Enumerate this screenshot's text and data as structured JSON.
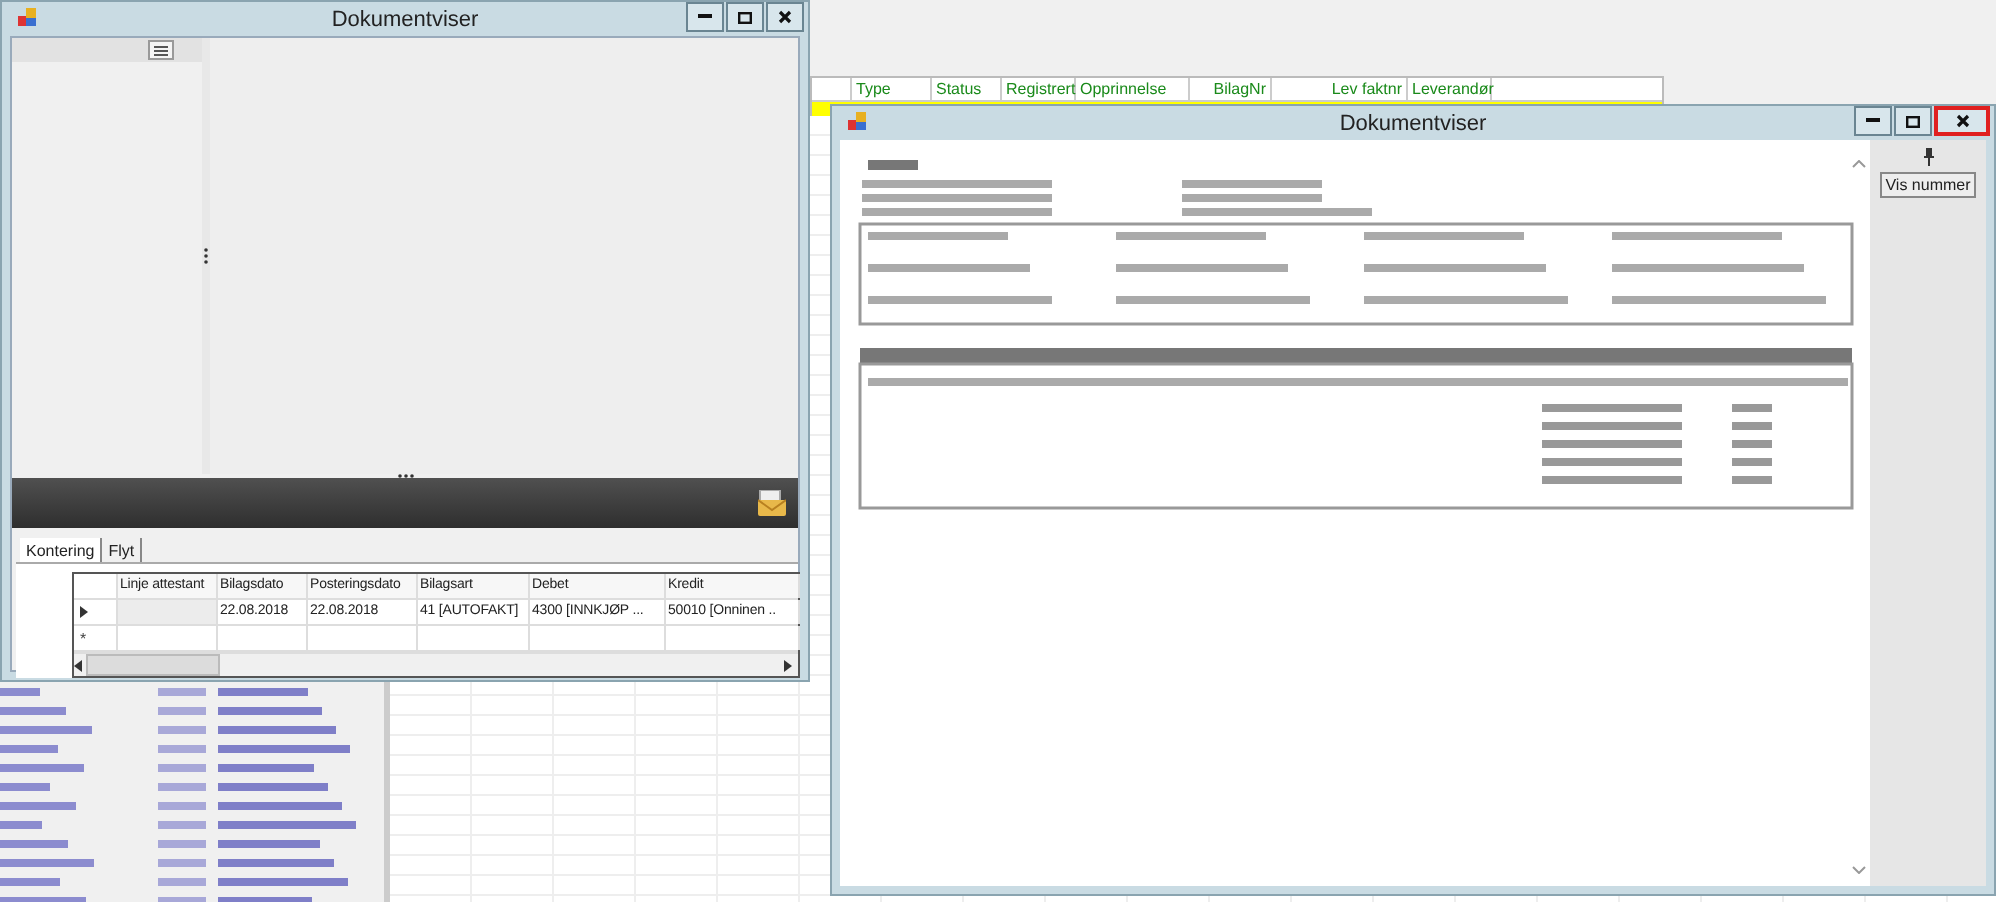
{
  "background_grid": {
    "columns": [
      "Type",
      "Status",
      "Registrert",
      "Opprinnelse",
      "BilagNr",
      "Lev faktnr",
      "Leverandør"
    ]
  },
  "viewer_back": {
    "title": "Dokumentviser",
    "tabs": [
      {
        "label": "Kontering",
        "selected": true
      },
      {
        "label": "Flyt",
        "selected": false
      }
    ],
    "grid": {
      "columns": [
        "Linje attestant",
        "Bilagsdato",
        "Posteringsdato",
        "Bilagsart",
        "Debet",
        "Kredit"
      ],
      "rows": [
        {
          "current": true,
          "cells": [
            "",
            "22.08.2018",
            "22.08.2018",
            "41 [AUTOFAKT]",
            "4300 [INNKJØP ...",
            "50010 [Onninen .."
          ]
        }
      ],
      "new_row_marker": "*"
    }
  },
  "viewer_front": {
    "title": "Dokumentviser",
    "close_highlighted": true,
    "buttons": [
      "Vis nummer"
    ]
  }
}
